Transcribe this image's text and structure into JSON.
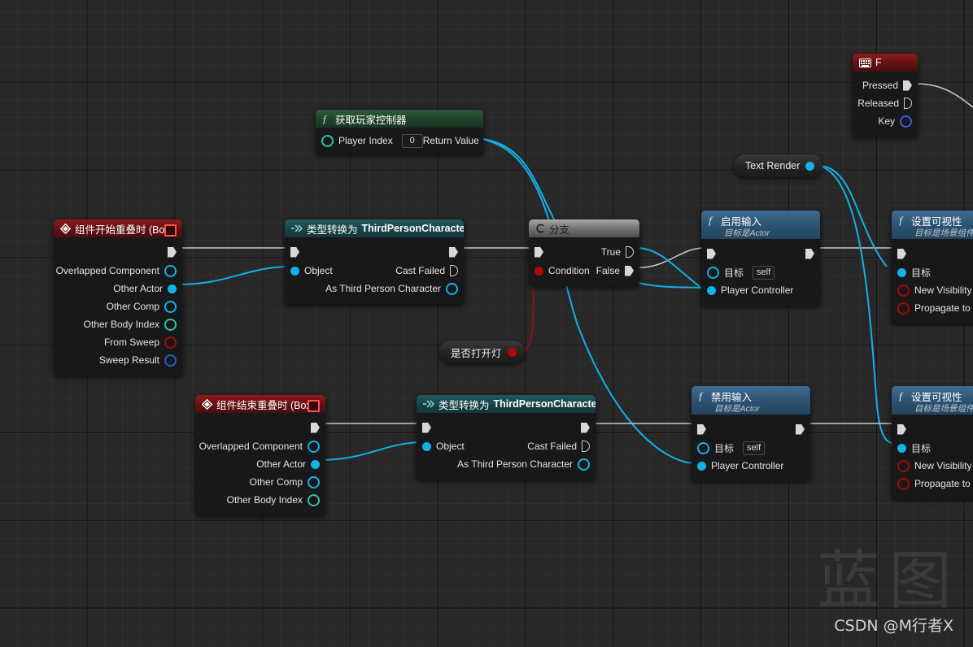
{
  "app": {
    "editor": "Unreal Engine Blueprint Graph",
    "watermark_big": "蓝图",
    "watermark_small": "CSDN @M行者X"
  },
  "colors": {
    "exec_white": "#d8d8d8",
    "object_blue": "#12b1e8",
    "bool_red": "#b30707",
    "int_green": "#2ec4a0",
    "struct_blue": "#1a63c8",
    "event_red": "#8d1a1a",
    "function_blue": "#3d6c94",
    "pure_green": "#2d5a38",
    "cast_teal": "#1f5a5e",
    "flow_grey": "#a8a8a8"
  },
  "nodes": {
    "begin_overlap": {
      "title": "组件开始重叠时 (Box)",
      "icon": "event-diamond-icon",
      "pins": [
        {
          "label": "Overlapped Component",
          "type": "object",
          "filled": false
        },
        {
          "label": "Other Actor",
          "type": "object",
          "filled": true
        },
        {
          "label": "Other Comp",
          "type": "object",
          "filled": false
        },
        {
          "label": "Other Body Index",
          "type": "int",
          "filled": false
        },
        {
          "label": "From Sweep",
          "type": "bool",
          "filled": false
        },
        {
          "label": "Sweep Result",
          "type": "struct",
          "filled": false
        }
      ]
    },
    "end_overlap": {
      "title": "组件结束重叠时 (Box)",
      "icon": "event-diamond-icon",
      "pins": [
        {
          "label": "Overlapped Component",
          "type": "object",
          "filled": false
        },
        {
          "label": "Other Actor",
          "type": "object",
          "filled": true
        },
        {
          "label": "Other Comp",
          "type": "object",
          "filled": false
        },
        {
          "label": "Other Body Index",
          "type": "int",
          "filled": false
        }
      ]
    },
    "get_player_controller": {
      "title": "获取玩家控制器",
      "icon": "function-f-icon",
      "input_label": "Player Index",
      "input_value": "0",
      "output_label": "Return Value"
    },
    "cast_top": {
      "title_prefix": "类型转换为",
      "title_class": "ThirdPersonCharacter",
      "icon": "cast-arrows-icon",
      "input_object": "Object",
      "out_failed": "Cast Failed",
      "out_as": "As Third Person Character"
    },
    "cast_bottom": {
      "title_prefix": "类型转换为",
      "title_class": "ThirdPersonCharacter",
      "icon": "cast-arrows-icon",
      "input_object": "Object",
      "out_failed": "Cast Failed",
      "out_as": "As Third Person Character"
    },
    "branch": {
      "title": "分支",
      "icon": "branch-icon",
      "condition": "Condition",
      "out_true": "True",
      "out_false": "False"
    },
    "enable_input": {
      "title": "启用输入",
      "subtitle": "目标是Actor",
      "icon": "function-f-icon",
      "target_label": "目标",
      "target_value": "self",
      "controller_label": "Player Controller"
    },
    "disable_input": {
      "title": "禁用输入",
      "subtitle": "目标是Actor",
      "icon": "function-f-icon",
      "target_label": "目标",
      "target_value": "self",
      "controller_label": "Player Controller"
    },
    "set_visibility_top": {
      "title": "设置可视性",
      "subtitle": "目标是场景组件",
      "icon": "function-f-icon",
      "target_label": "目标",
      "new_visibility_label": "New Visibility",
      "propagate_label": "Propagate to C"
    },
    "set_visibility_bottom": {
      "title": "设置可视性",
      "subtitle": "目标是场景组件",
      "icon": "function-f-icon",
      "target_label": "目标",
      "new_visibility_label": "New Visibility",
      "propagate_label": "Propagate to Chi"
    },
    "key_f_event": {
      "title": "F",
      "icon": "keyboard-icon",
      "pins": [
        {
          "label": "Pressed",
          "type": "exec",
          "filled": true
        },
        {
          "label": "Released",
          "type": "exec",
          "filled": false
        },
        {
          "label": "Key",
          "type": "key",
          "filled": false
        }
      ]
    },
    "var_light_bool": {
      "title": "是否打开灯",
      "pin_type": "bool"
    },
    "var_text_render": {
      "title": "Text Render",
      "pin_type": "object"
    }
  }
}
